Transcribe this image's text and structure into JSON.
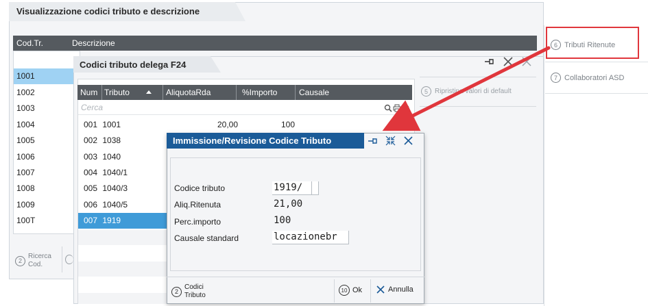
{
  "outer": {
    "title": "Visualizzazione codici tributo e descrizione",
    "col_cod": "Cod.Tr.",
    "col_desc": "Descrizione",
    "codes": [
      "1001",
      "1002",
      "1003",
      "1004",
      "1005",
      "1006",
      "1007",
      "1008",
      "1009",
      "100T"
    ],
    "btn_ricerca": "Ricerca",
    "btn_ricerca_2": "Cod.",
    "btn_ricerca_num": "2"
  },
  "side": {
    "item1": "Tributi Ritenute",
    "item1_num": "6",
    "item2": "Collaboratori ASD",
    "item2_num": "7"
  },
  "f24": {
    "title": "Codici tributo delega F24",
    "headers": [
      "Num",
      "Tributo",
      "AliquotaRda",
      "%Importo",
      "Causale"
    ],
    "search_placeholder": "Cerca",
    "restore_label": "Ripristina valori di default",
    "restore_num": "5",
    "rows": [
      {
        "num": "001",
        "tributo": "1001",
        "aliquota": "20,00",
        "importo": "100"
      },
      {
        "num": "002",
        "tributo": "1038",
        "aliquota": "",
        "importo": ""
      },
      {
        "num": "003",
        "tributo": "1040",
        "aliquota": "",
        "importo": ""
      },
      {
        "num": "004",
        "tributo": "1040/1",
        "aliquota": "",
        "importo": ""
      },
      {
        "num": "005",
        "tributo": "1040/3",
        "aliquota": "",
        "importo": ""
      },
      {
        "num": "006",
        "tributo": "1040/5",
        "aliquota": "",
        "importo": ""
      },
      {
        "num": "007",
        "tributo": "1919",
        "aliquota": "",
        "importo": ""
      }
    ]
  },
  "dialog": {
    "title": "Immissione/Revisione Codice Tributo",
    "fields": [
      {
        "label": "Codice tributo",
        "value": "1919/"
      },
      {
        "label": "Aliq.Ritenuta",
        "value": "21,00"
      },
      {
        "label": "Perc.importo",
        "value": "100"
      },
      {
        "label": "Causale standard",
        "value": "locazionebr"
      }
    ],
    "btn_codici_num": "2",
    "btn_codici_1": "Codici",
    "btn_codici_2": "Tributo",
    "btn_ok_num": "10",
    "btn_ok": "Ok",
    "btn_annulla": "Annulla"
  },
  "colors": {
    "header_bg": "#555a5f",
    "selected_row": "#3f9bd8",
    "dialog_title": "#1b5b98",
    "highlight_red": "#e0363c"
  }
}
